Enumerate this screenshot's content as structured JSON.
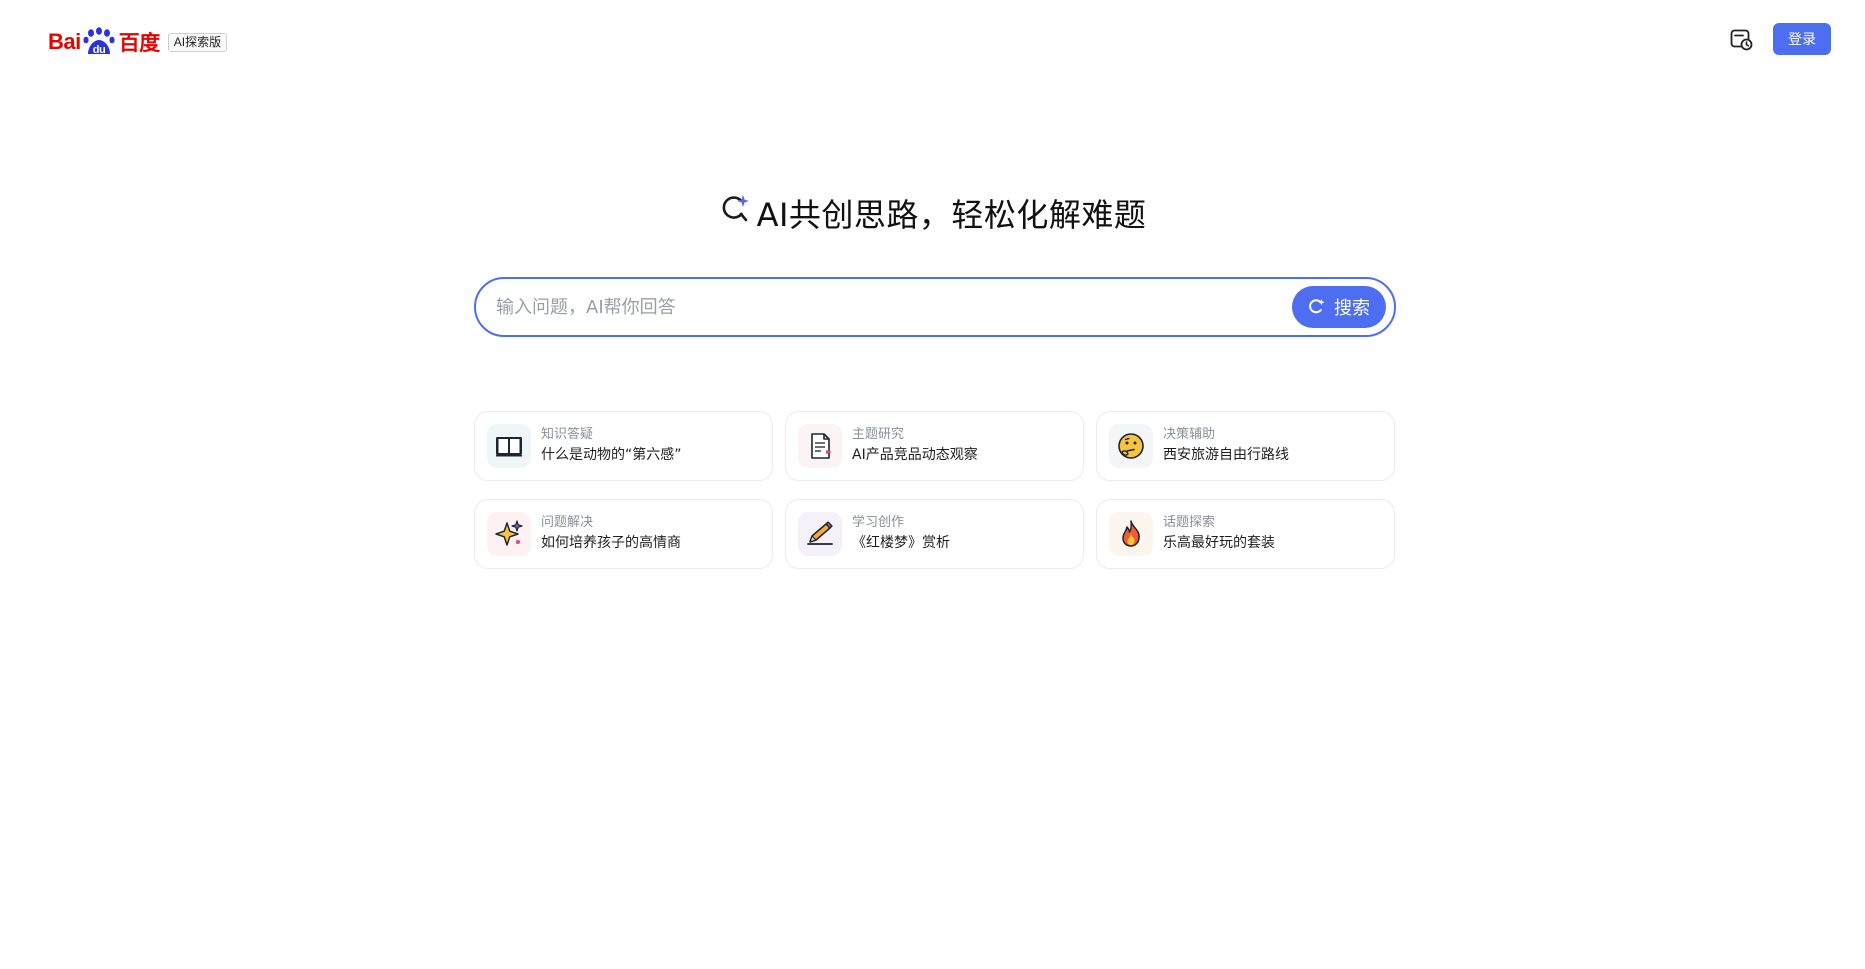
{
  "header": {
    "logo": {
      "bai": "Bai",
      "du": "du",
      "cn": "百度",
      "badge": "AI探索版"
    },
    "history_icon": "history-icon",
    "login_label": "登录"
  },
  "hero": {
    "icon": "ai-search-sparkle-icon",
    "title": "AI共创思路，轻松化解难题"
  },
  "search": {
    "placeholder": "输入问题，AI帮你回答",
    "value": "",
    "button_label": "搜索",
    "button_icon": "ai-search-icon"
  },
  "cards": [
    {
      "category": "知识答疑",
      "title": "什么是动物的“第六感”",
      "icon": "open-book-icon",
      "icon_bg": "#eef6f8"
    },
    {
      "category": "主题研究",
      "title": "AI产品竞品动态观察",
      "icon": "document-icon",
      "icon_bg": "#fbf3f4"
    },
    {
      "category": "决策辅助",
      "title": "西安旅游自由行路线",
      "icon": "thinking-face-icon",
      "icon_bg": "#f4f5f7"
    },
    {
      "category": "问题解决",
      "title": "如何培养孩子的高情商",
      "icon": "sparkles-icon",
      "icon_bg": "#fdf1f1"
    },
    {
      "category": "学习创作",
      "title": "《红楼梦》赏析",
      "icon": "pencil-writing-icon",
      "icon_bg": "#f5f1fa"
    },
    {
      "category": "话题探索",
      "title": "乐高最好玩的套装",
      "icon": "fire-icon",
      "icon_bg": "#fdf6ee"
    }
  ],
  "colors": {
    "accent": "#4e6ef2",
    "baidu_red": "#e10601",
    "baidu_blue": "#2932e1"
  }
}
